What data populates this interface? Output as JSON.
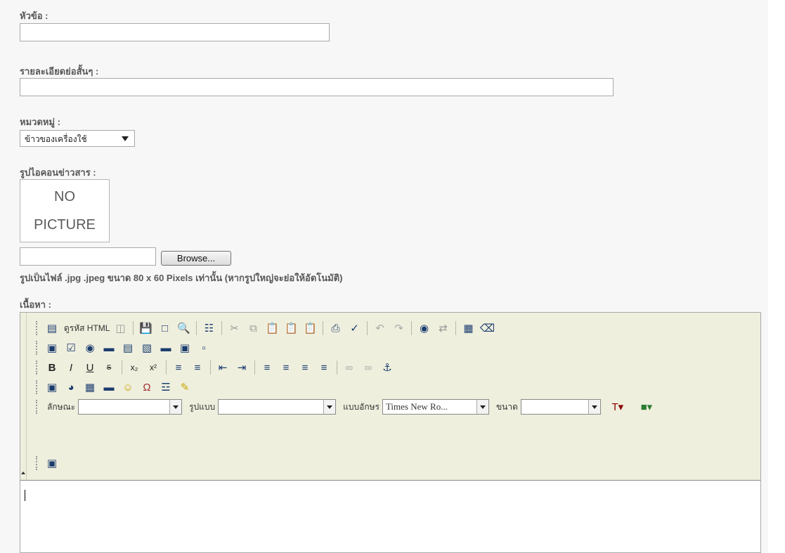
{
  "fields": {
    "title_label": "หัวข้อ :",
    "title_value": "",
    "summary_label": "รายละเอียดย่อสั้นๆ :",
    "summary_value": "",
    "category_label": "หมวดหมู่ :",
    "category_selected": "ข้าวของเครื่องใช้",
    "icon_label": "รูปไอคอนข่าวสาร :",
    "no_picture_line1": "NO",
    "no_picture_line2": "PICTURE",
    "file_value": "",
    "browse_label": "Browse...",
    "image_hint": "รูปเป็นไฟล์ .jpg .jpeg ขนาด 80 x 60 Pixels เท่านั้น (หากรูปใหญ่จะย่อให้อัตโนมัติ)",
    "content_label": "เนื้อหา :"
  },
  "editor": {
    "source_label": "ดูรหัส HTML",
    "style_label": "ลักษณะ",
    "style_value": "",
    "format_label": "รูปแบบ",
    "format_value": "",
    "font_label": "แบบอักษร",
    "font_value": "Times New Ro...",
    "size_label": "ขนาด",
    "size_value": ""
  }
}
